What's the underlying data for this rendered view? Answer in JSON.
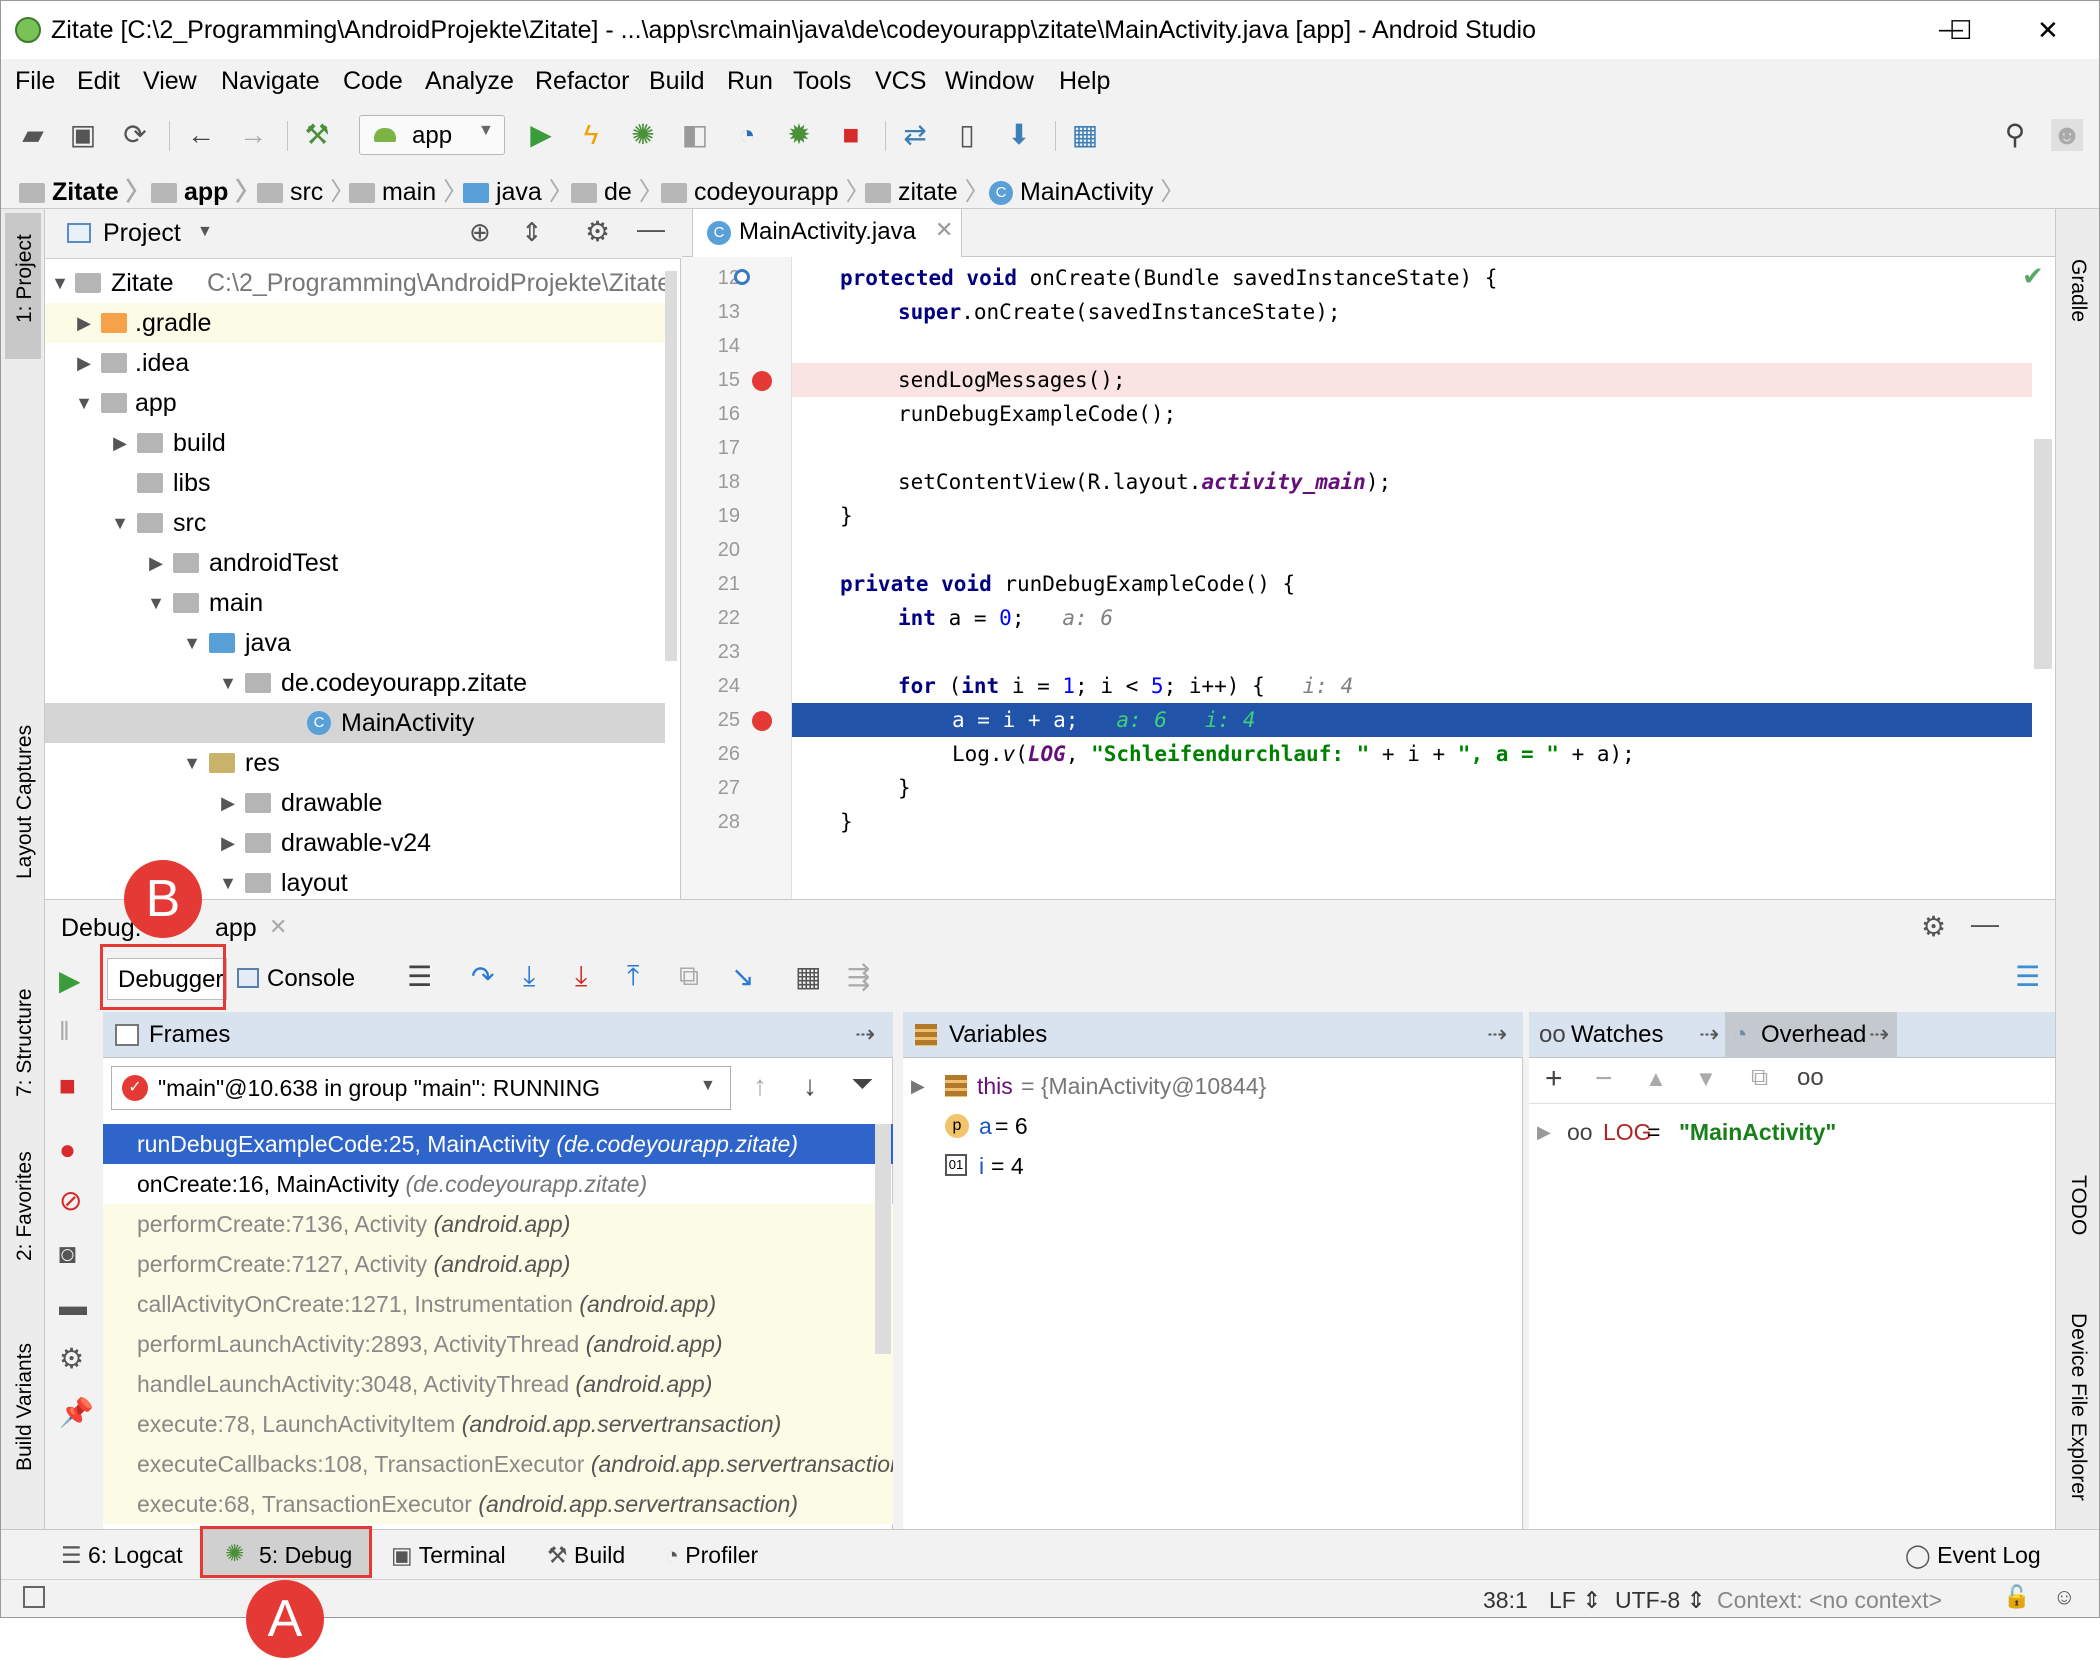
{
  "window": {
    "title": "Zitate [C:\\2_Programming\\AndroidProjekte\\Zitate] - ...\\app\\src\\main\\java\\de\\codeyourapp\\zitate\\MainActivity.java [app] - Android Studio",
    "minimize": "—",
    "maximize": "☐",
    "close": "✕"
  },
  "menu": [
    "File",
    "Edit",
    "View",
    "Navigate",
    "Code",
    "Analyze",
    "Refactor",
    "Build",
    "Run",
    "Tools",
    "VCS",
    "Window",
    "Help"
  ],
  "toolbar": {
    "run_config": "app"
  },
  "breadcrumbs": [
    "Zitate",
    "app",
    "src",
    "main",
    "java",
    "de",
    "codeyourapp",
    "zitate",
    "MainActivity"
  ],
  "project": {
    "header": "Project",
    "root_name": "Zitate",
    "root_path": "C:\\2_Programming\\AndroidProjekte\\Zitate",
    "items": [
      ".gradle",
      ".idea",
      "app",
      "build",
      "libs",
      "src",
      "androidTest",
      "main",
      "java",
      "de.codeyourapp.zitate",
      "MainActivity",
      "res",
      "drawable",
      "drawable-v24",
      "layout"
    ]
  },
  "left_tabs": {
    "project": "1: Project",
    "layout_captures": "Layout Captures",
    "structure": "7: Structure",
    "favorites": "2: Favorites",
    "build_variants": "Build Variants"
  },
  "right_tabs": {
    "gradle": "Gradle",
    "todo": "TODO",
    "device_file_explorer": "Device File Explorer"
  },
  "editor": {
    "tab": "MainActivity.java",
    "line_numbers": [
      "12",
      "13",
      "14",
      "15",
      "16",
      "17",
      "18",
      "19",
      "20",
      "21",
      "22",
      "23",
      "24",
      "25",
      "26",
      "27",
      "28"
    ],
    "code": {
      "l12a": "protected void",
      "l12b": " onCreate(Bundle savedInstanceState) {",
      "l13a": "super",
      ".l13b": "",
      "l13b": ".onCreate(savedInstanceState);",
      "l15": "sendLogMessages();",
      "l16": "runDebugExampleCode();",
      "l18a": "setContentView(R.layout.",
      "l18b": "activity_main",
      "l18c": ");",
      "l19": "}",
      "l21a": "private void",
      "l21b": " runDebugExampleCode() {",
      "l22a": "int",
      "l22b": " a = ",
      "l22c": "0",
      "l22d": ";",
      "l22hint": "a: 6",
      "l24a": "for",
      "l24b": " (",
      "l24c": "int",
      "l24d": " i = ",
      "l24e": "1",
      "l24f": "; i < ",
      "l24g": "5",
      "l24h": "; i++) {",
      "l24hint": "i: 4",
      "l25": "a = i + a;",
      "l25hint1": "a: 6",
      "l25hint2": "i: 4",
      "l26a": "Log.",
      "l26b": "v",
      "l26c": "(",
      "l26d": "LOG",
      "l26e": ", ",
      "l26f": "\"Schleifendurchlauf: \"",
      "l26g": " + i + ",
      "l26h": "\", a = \"",
      "l26i": " + a);",
      "l27": "}",
      "l28": "}"
    }
  },
  "debug": {
    "label": "Debug:",
    "config": "app",
    "tab_debugger": "Debugger",
    "tab_console": "Console",
    "frames_title": "Frames",
    "variables_title": "Variables",
    "watches_title": "Watches",
    "overhead_title": "Overhead",
    "thread": "\"main\"@10.638 in group \"main\": RUNNING",
    "frames": [
      {
        "m": "runDebugExampleCode:25, MainActivity",
        "p": "(de.codeyourapp.zitate)"
      },
      {
        "m": "onCreate:16, MainActivity",
        "p": "(de.codeyourapp.zitate)"
      },
      {
        "m": "performCreate:7136, Activity",
        "p": "(android.app)"
      },
      {
        "m": "performCreate:7127, Activity",
        "p": "(android.app)"
      },
      {
        "m": "callActivityOnCreate:1271, Instrumentation",
        "p": "(android.app)"
      },
      {
        "m": "performLaunchActivity:2893, ActivityThread",
        "p": "(android.app)"
      },
      {
        "m": "handleLaunchActivity:3048, ActivityThread",
        "p": "(android.app)"
      },
      {
        "m": "execute:78, LaunchActivityItem",
        "p": "(android.app.servertransaction)"
      },
      {
        "m": "executeCallbacks:108, TransactionExecutor",
        "p": "(android.app.servertransaction)"
      },
      {
        "m": "execute:68, TransactionExecutor",
        "p": "(android.app.servertransaction)"
      }
    ],
    "variables": [
      {
        "name": "this",
        "value": " = {MainActivity@10844}"
      },
      {
        "name": "a",
        "value": " = 6"
      },
      {
        "name": "i",
        "value": " = 4"
      }
    ],
    "watch": {
      "name": "LOG",
      "eq": " = ",
      "value": "\"MainActivity\""
    }
  },
  "bottom_tabs": {
    "logcat": "6: Logcat",
    "debug": "5: Debug",
    "terminal": "Terminal",
    "build": "Build",
    "profiler": "Profiler",
    "event_log": "Event Log"
  },
  "status": {
    "position": "38:1",
    "line_sep": "LF ⇕",
    "encoding": "UTF-8 ⇕",
    "context": "Context: <no context>"
  },
  "annotations": {
    "a": "A",
    "b": "B"
  }
}
